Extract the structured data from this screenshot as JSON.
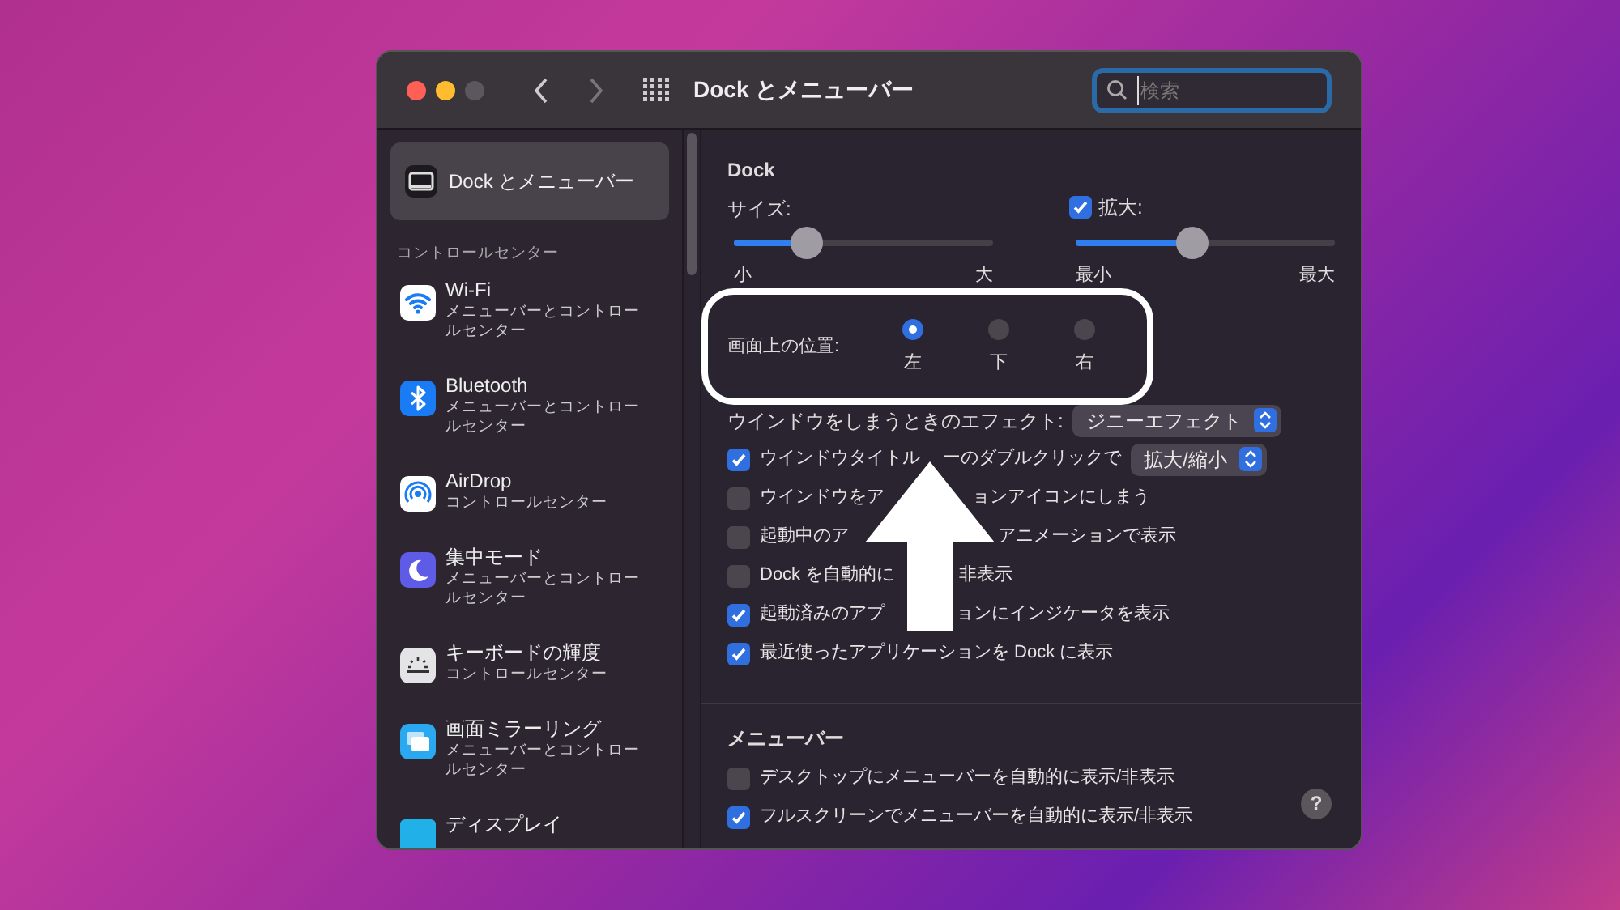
{
  "window": {
    "title": "Dock とメニューバー"
  },
  "search": {
    "placeholder": "検索"
  },
  "sidebar": {
    "items": [
      {
        "kind": "dock",
        "label": "Dock とメニューバー",
        "selected": true
      }
    ],
    "section": "コントロールセンター",
    "modules": [
      {
        "kind": "wifi",
        "label": "Wi-Fi",
        "subtitle": "メニューバーとコントロールセンター"
      },
      {
        "kind": "bluetooth",
        "label": "Bluetooth",
        "subtitle": "メニューバーとコントロールセンター"
      },
      {
        "kind": "airdrop",
        "label": "AirDrop",
        "subtitle": "コントロールセンター"
      },
      {
        "kind": "focus",
        "label": "集中モード",
        "subtitle": "メニューバーとコントロールセンター"
      },
      {
        "kind": "keyboard",
        "label": "キーボードの輝度",
        "subtitle": "コントロールセンター"
      },
      {
        "kind": "mirroring",
        "label": "画面ミラーリング",
        "subtitle": "メニューバーとコントロールセンター"
      },
      {
        "kind": "display",
        "label": "ディスプレイ"
      }
    ]
  },
  "dock": {
    "heading": "Dock",
    "size": {
      "label": "サイズ:",
      "level": 0.28,
      "min_label": "小",
      "max_label": "大"
    },
    "magnification": {
      "label": "拡大:",
      "checked": true,
      "level": 0.45,
      "min_label": "最小",
      "max_label": "最大"
    },
    "position": {
      "label": "画面上の位置:",
      "options": [
        {
          "label": "左",
          "selected": true
        },
        {
          "label": "下",
          "selected": false
        },
        {
          "label": "右",
          "selected": false
        }
      ]
    },
    "minimize_effect": {
      "label": "ウインドウをしまうときのエフェクト:",
      "value": "ジニーエフェクト"
    },
    "options": [
      {
        "parts": [
          "ウインドウタイトル",
          "ーのダブルクリックで"
        ],
        "checked": true,
        "popup": "拡大/縮小"
      },
      {
        "parts": [
          "ウインドウをア",
          "ョンアイコンにしまう"
        ],
        "checked": false
      },
      {
        "parts": [
          "起動中のア",
          "アニメーションで表示"
        ],
        "checked": false
      },
      {
        "parts": [
          "Dock を自動的に",
          "非表示"
        ],
        "checked": false
      },
      {
        "parts": [
          "起動済みのアプ",
          "ョンにインジケータを表示"
        ],
        "checked": true
      },
      {
        "parts": [
          "最近使ったアプリケーションを Dock に表示"
        ],
        "checked": true
      }
    ]
  },
  "menubar": {
    "heading": "メニューバー",
    "options": [
      {
        "parts": [
          "デスクトップにメニューバーを自動的に表示/非表示"
        ],
        "checked": false
      },
      {
        "parts": [
          "フルスクリーンでメニューバーを自動的に表示/非表示"
        ],
        "checked": true
      }
    ]
  },
  "help": "?"
}
